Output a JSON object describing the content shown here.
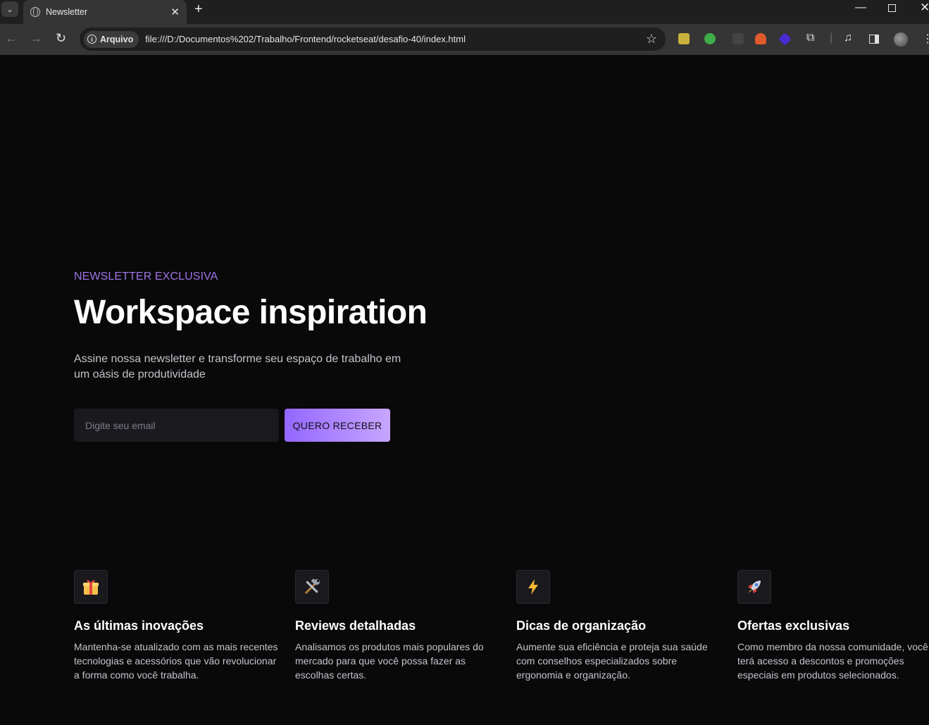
{
  "browser": {
    "tab_title": "Newsletter",
    "site_chip": "Arquivo",
    "url": "file:///D:/Documentos%202/Trabalho/Frontend/rocketseat/desafio-40/index.html"
  },
  "hero": {
    "tag": "NEWSLETTER EXCLUSIVA",
    "title": "Workspace inspiration",
    "description": "Assine nossa newsletter e transforme seu espaço de trabalho em um oásis de produtividade",
    "email_placeholder": "Digite seu email",
    "email_value": "",
    "submit_label": "QUERO RECEBER"
  },
  "features": [
    {
      "icon": "gift-icon",
      "title": "As últimas inovações",
      "text": "Mantenha-se atualizado com as mais recentes tecnologias e acessórios que vão revolucionar a forma como você trabalha."
    },
    {
      "icon": "tools-icon",
      "title": "Reviews detalhadas",
      "text": "Analisamos os produtos mais populares do mercado para que você possa fazer as escolhas certas."
    },
    {
      "icon": "lightning-icon",
      "title": "Dicas de organização",
      "text": "Aumente sua eficiência e proteja sua saúde com conselhos especializados sobre ergonomia e organização."
    },
    {
      "icon": "rocket-icon",
      "title": "Ofertas exclusivas",
      "text": "Como membro da nossa comunidade, você terá acesso a descontos e promoções especiais em produtos selecionados."
    }
  ],
  "colors": {
    "accent": "#9f74e6",
    "button_gradient_start": "#9466ff",
    "button_gradient_end": "#c7a6ff",
    "background": "#09090a"
  }
}
